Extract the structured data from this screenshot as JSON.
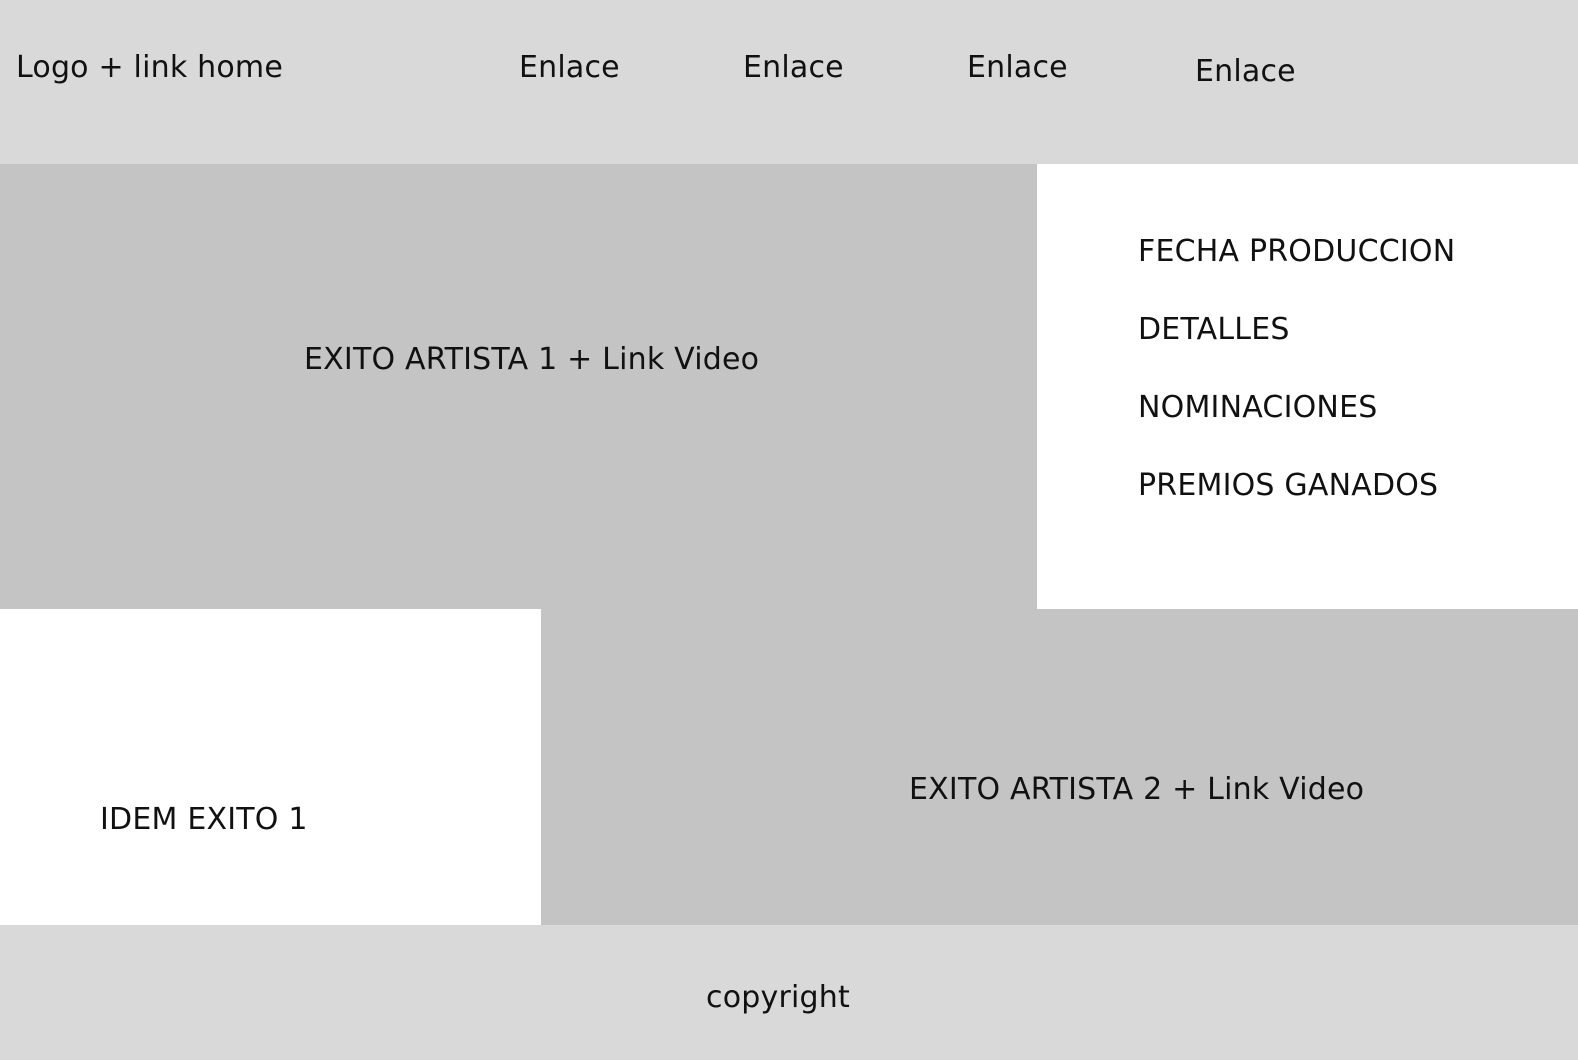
{
  "header": {
    "logo_label": "Logo + link home",
    "nav_links": [
      "Enlace",
      "Enlace",
      "Enlace",
      "Enlace"
    ]
  },
  "hero1": {
    "label": "EXITO ARTISTA 1 + Link Video"
  },
  "details": {
    "items": [
      "FECHA PRODUCCION",
      "DETALLES",
      "NOMINACIONES",
      "PREMIOS GANADOS"
    ]
  },
  "idem": {
    "label": "IDEM EXITO 1"
  },
  "hero2": {
    "label": "EXITO ARTISTA 2 + Link Video"
  },
  "footer": {
    "copyright": "copyright"
  },
  "colors": {
    "header_bg": "#d9d9d9",
    "hero_bg": "#c4c4c4",
    "panel_bg": "#ffffff",
    "footer_bg": "#d9d9d9",
    "text": "#111111"
  }
}
